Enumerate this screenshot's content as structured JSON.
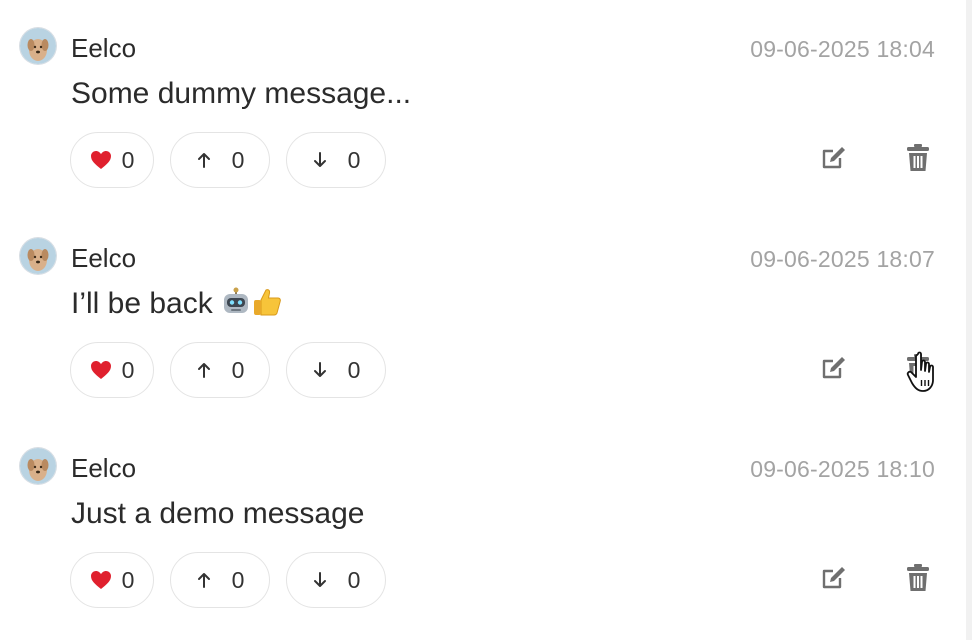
{
  "messages": [
    {
      "author": "Eelco",
      "timestamp": "09-06-2025 18:04",
      "text": "Some dummy message...",
      "reactions": {
        "heart": "0",
        "up": "0",
        "down": "0"
      }
    },
    {
      "author": "Eelco",
      "timestamp": "09-06-2025 18:07",
      "text": "I’ll be back ",
      "emojis": [
        "robot-emoji",
        "thumbs-up-emoji"
      ],
      "reactions": {
        "heart": "0",
        "up": "0",
        "down": "0"
      }
    },
    {
      "author": "Eelco",
      "timestamp": "09-06-2025 18:10",
      "text": "Just a demo message",
      "reactions": {
        "heart": "0",
        "up": "0",
        "down": "0"
      }
    }
  ],
  "icons": {
    "heart": "heart-icon",
    "up": "arrow-up-icon",
    "down": "arrow-down-icon",
    "edit": "edit-icon",
    "delete": "trash-icon"
  },
  "colors": {
    "heart": "#e0202e",
    "timestamp": "#a3a3a3",
    "icon": "#6f6f6f",
    "border": "#e4e4e4"
  }
}
